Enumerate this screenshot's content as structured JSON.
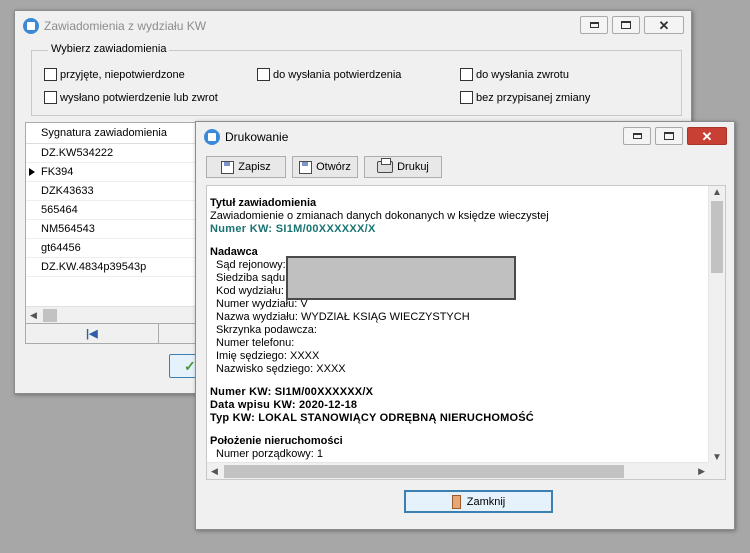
{
  "main_window": {
    "title": "Zawiadomienia z wydziału KW",
    "group_title": "Wybierz zawiadomienia",
    "filters": [
      {
        "label": "przyjęte, niepotwierdzone"
      },
      {
        "label": "do wysłania potwierdzenia"
      },
      {
        "label": "do wysłania zwrotu"
      },
      {
        "label": "wysłano potwierdzenie lub zwrot"
      },
      {
        "label": "bez przypisanej zmiany"
      }
    ],
    "grid": {
      "column_header": "Sygnatura zawiadomienia",
      "rows": [
        "DZ.KW534222",
        "FK394",
        "DZK43633",
        "565464",
        "NM564543",
        "gt64456",
        "DZ.KW.4834p39543p"
      ]
    }
  },
  "print_window": {
    "title": "Drukowanie",
    "toolbar": {
      "save": "Zapisz",
      "open": "Otwórz",
      "print": "Drukuj"
    },
    "document": {
      "title_heading": "Tytuł zawiadomienia",
      "title_text": "Zawiadomienie o zmianach danych dokonanych w księdze wieczystej",
      "kw_number_line": "Numer KW: SI1M/00XXXXXX/X",
      "sender_heading": "Nadawca",
      "sender_fields": [
        "Sąd rejonowy:",
        "Siedziba sądu:",
        "Kod wydziału:",
        "Numer wydziału: V",
        "Nazwa wydziału: WYDZIAŁ KSIĄG WIECZYSTYCH",
        "Skrzynka podawcza:",
        "Numer telefonu:",
        "Imię sędziego: XXXX",
        "Nazwisko sędziego: XXXX"
      ],
      "kw_number_bold": "Numer KW: SI1M/00XXXXXX/X",
      "entry_date": "Data wpisu KW: 2020-12-18",
      "kw_type": "Typ KW: LOKAL STANOWIĄCY ODRĘBNĄ NIERUCHOMOŚĆ",
      "location_heading": "Położenie nieruchomości",
      "partial_line": "Numer porządkowy: 1"
    },
    "close_label": "Zamknij"
  }
}
